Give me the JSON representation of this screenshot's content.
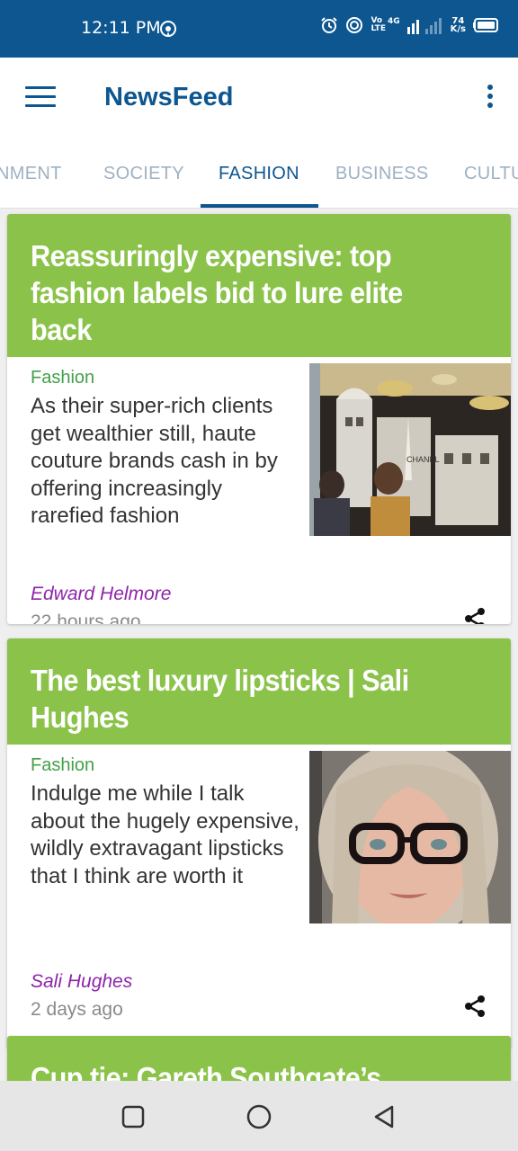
{
  "status_bar": {
    "time": "12:11 PM",
    "network_top": "Vo",
    "network_bottom": "LTE",
    "network_gen": "4G",
    "speed_value": "74",
    "speed_unit": "K/s",
    "icons": [
      "hotspot-icon",
      "alarm-icon",
      "signal-icon",
      "battery-icon"
    ]
  },
  "app_bar": {
    "title": "NewsFeed",
    "menu_icon": "hamburger-menu-icon",
    "overflow_icon": "more-vert-icon"
  },
  "tabs": [
    {
      "label": "NMENT",
      "active": false
    },
    {
      "label": "SOCIETY",
      "active": false
    },
    {
      "label": "FASHION",
      "active": true
    },
    {
      "label": "BUSINESS",
      "active": false
    },
    {
      "label": "CULTU",
      "active": false
    }
  ],
  "articles": [
    {
      "title": "Reassuringly expensive: top fashion labels bid to lure elite back",
      "section": "Fashion",
      "description": "As their super-rich clients get wealthier still, haute couture brands cash in by offering increasingly rarefied fashion",
      "author": "Edward Helmore",
      "time": "22 hours ago",
      "image": "shop-window-photo",
      "image_caption": "CHANEL"
    },
    {
      "title": "The best luxury lipsticks | Sali Hughes",
      "section": "Fashion",
      "description": "Indulge me while I talk about the hugely expensive, wildly extravagant lipsticks that I think are worth it",
      "author": "Sali Hughes",
      "time": "2 days ago",
      "image": "portrait-photo"
    },
    {
      "title": "Cup tie: Gareth Southgate’s lucky"
    }
  ],
  "nav_bar": {
    "icons": [
      "recents-square-icon",
      "home-circle-icon",
      "back-triangle-icon"
    ]
  },
  "colors": {
    "primary": "#0d5690",
    "card_header": "#8bc34a",
    "section": "#43a047",
    "author": "#8e24aa"
  }
}
